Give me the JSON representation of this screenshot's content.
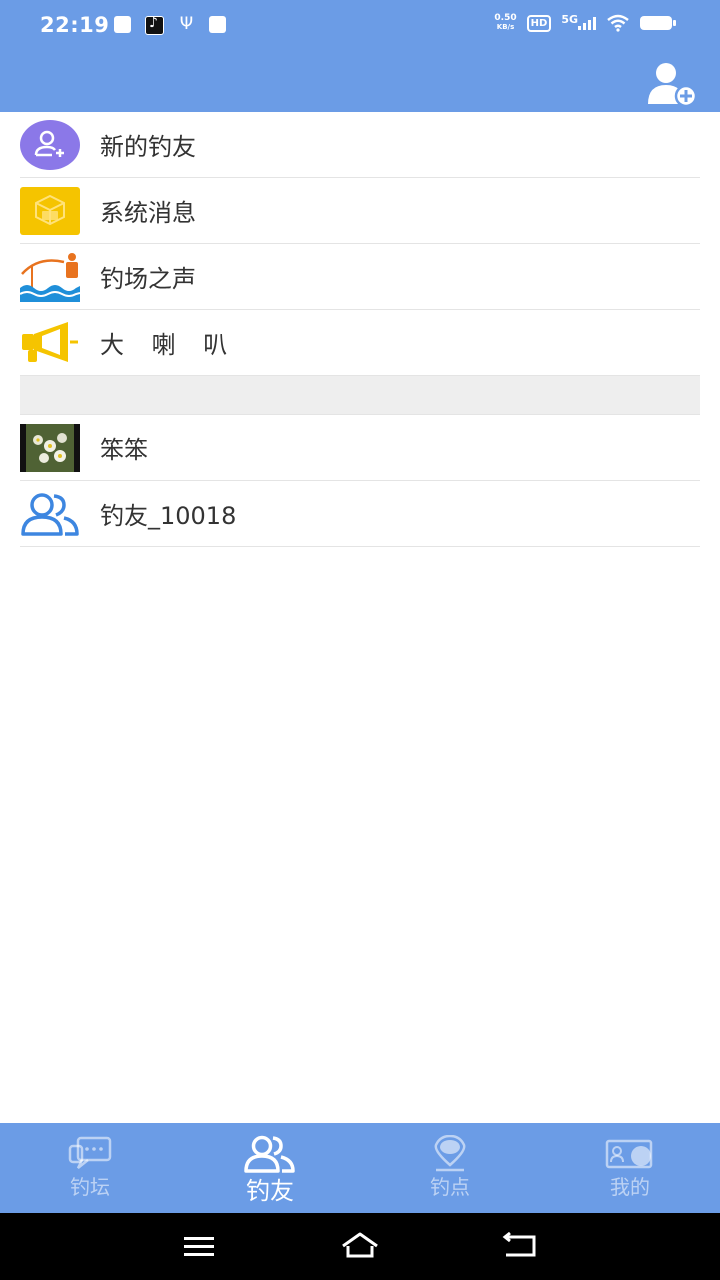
{
  "status_bar": {
    "time": "22:19",
    "net_speed_value": "0.50",
    "net_speed_unit": "KB/s",
    "hd": "HD",
    "network": "5G",
    "left_icons": [
      "message-notification-icon",
      "tiktok-icon",
      "usb-icon",
      "mail-icon"
    ],
    "right_icons": [
      "wifi-icon",
      "battery-icon"
    ]
  },
  "header": {
    "action_icon": "add-friend-icon"
  },
  "system_items": [
    {
      "label": "新的钓友",
      "icon": "new-friend-icon",
      "color": "#8b78e8"
    },
    {
      "label": "系统消息",
      "icon": "system-message-icon",
      "color": "#f5c400"
    },
    {
      "label": "钓场之声",
      "icon": "fishing-ground-icon",
      "color": "#e8731f"
    },
    {
      "label": "大 喇 叭",
      "icon": "megaphone-icon",
      "color": "#f5c400"
    }
  ],
  "contacts": [
    {
      "label": "笨笨",
      "icon": "photo-avatar"
    },
    {
      "label": "钓友_10018",
      "icon": "group-icon",
      "color": "#3d86e0"
    }
  ],
  "tabs": [
    {
      "label": "钓坛",
      "icon": "forum-icon",
      "active": false
    },
    {
      "label": "钓友",
      "icon": "friends-icon",
      "active": true
    },
    {
      "label": "钓点",
      "icon": "location-icon",
      "active": false
    },
    {
      "label": "我的",
      "icon": "profile-card-icon",
      "active": false
    }
  ],
  "nav_bar": {
    "buttons": [
      "menu-icon",
      "home-icon",
      "back-icon"
    ]
  },
  "colors": {
    "primary": "#6b9ce6",
    "divider": "#e4e4e4",
    "section_gap": "#eeeeee",
    "text": "#333333"
  }
}
